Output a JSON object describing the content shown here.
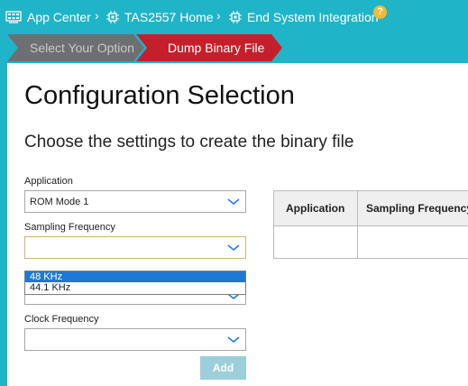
{
  "breadcrumb": {
    "items": [
      {
        "label": "App Center",
        "icon": "grid-app-icon"
      },
      {
        "label": "TAS2557 Home",
        "icon": "chip-icon"
      },
      {
        "label": "End System Integration",
        "icon": "chip-icon"
      }
    ],
    "separator": "›",
    "help_label": "?"
  },
  "steps": [
    {
      "label": "Select Your Option",
      "state": "inactive"
    },
    {
      "label": "Dump Binary File",
      "state": "active"
    }
  ],
  "main": {
    "title": "Configuration Selection",
    "subtitle": "Choose the settings to create the binary file"
  },
  "form": {
    "application_label": "Application",
    "application_value": "ROM Mode 1",
    "sampling_label": "Sampling Frequency",
    "sampling_value": "",
    "sampling_options": [
      "48 KHz",
      "44.1 KHz"
    ],
    "sampling_highlighted": "48 KHz",
    "clock_label": "Clock Frequency",
    "clock_value": "",
    "add_label": "Add"
  },
  "table": {
    "headers": [
      "Application",
      "Sampling Frequency"
    ],
    "rows": []
  },
  "colors": {
    "accent": "#1fb4c8",
    "active_step": "#c61f2c",
    "inactive_step": "#6d6f72",
    "selection": "#1e78d4",
    "help": "#f7b731"
  }
}
